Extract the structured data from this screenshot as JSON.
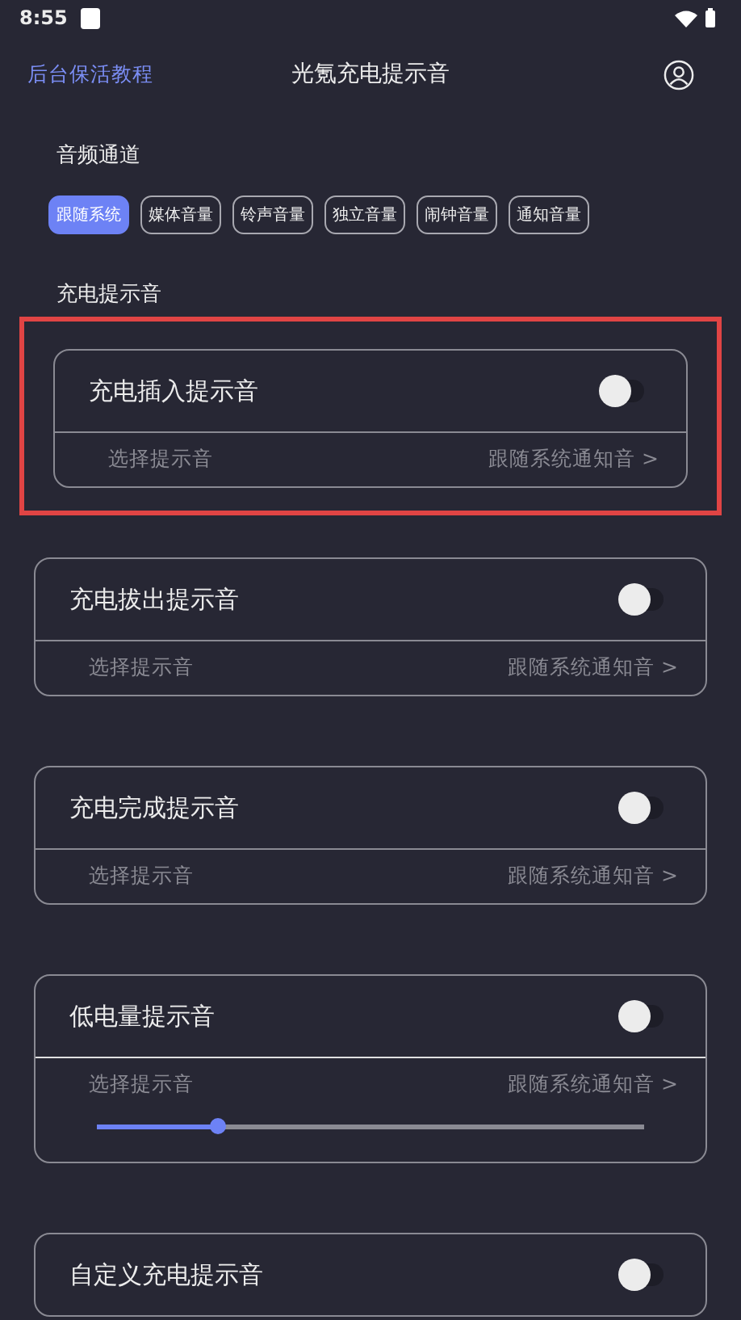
{
  "status_bar": {
    "time": "8:55"
  },
  "header": {
    "left_link": "后台保活教程",
    "title": "光氪充电提示音"
  },
  "audio_channel": {
    "label": "音频通道",
    "options": [
      {
        "label": "跟随系统",
        "selected": true
      },
      {
        "label": "媒体音量",
        "selected": false
      },
      {
        "label": "铃声音量",
        "selected": false
      },
      {
        "label": "独立音量",
        "selected": false
      },
      {
        "label": "闹钟音量",
        "selected": false
      },
      {
        "label": "通知音量",
        "selected": false
      }
    ]
  },
  "charge_section": {
    "label": "充电提示音",
    "cards": [
      {
        "title": "充电插入提示音",
        "on": false,
        "highlighted": true,
        "select_label": "选择提示音",
        "select_value": "跟随系统通知音 >"
      },
      {
        "title": "充电拔出提示音",
        "on": false,
        "highlighted": false,
        "select_label": "选择提示音",
        "select_value": "跟随系统通知音 >"
      },
      {
        "title": "充电完成提示音",
        "on": false,
        "highlighted": false,
        "select_label": "选择提示音",
        "select_value": "跟随系统通知音 >"
      },
      {
        "title": "低电量提示音",
        "on": false,
        "highlighted": false,
        "select_label": "选择提示音",
        "select_value": "跟随系统通知音 >",
        "level": 0.22
      },
      {
        "title": "自定义充电提示音",
        "on": false,
        "highlighted": false
      }
    ]
  }
}
